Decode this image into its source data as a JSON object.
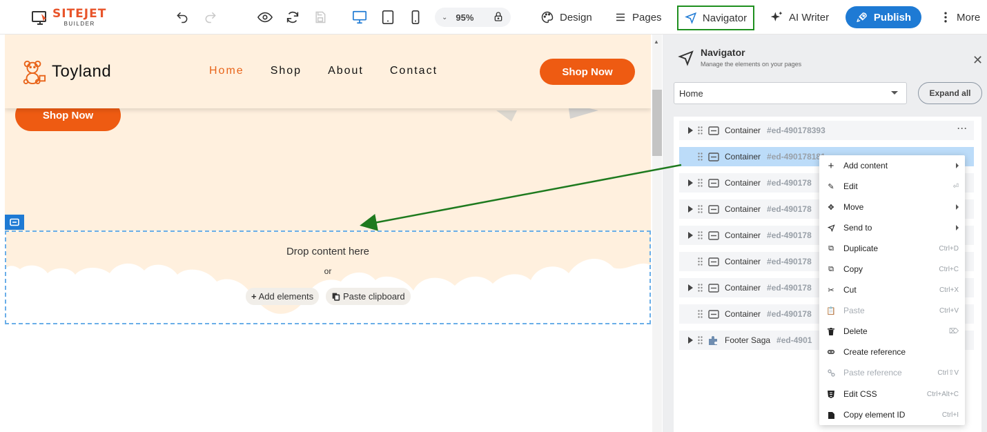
{
  "toolbar": {
    "logo_main": "SITEJET",
    "logo_sub": "BUILDER",
    "zoom": "95%",
    "design_label": "Design",
    "pages_label": "Pages",
    "navigator_label": "Navigator",
    "ai_writer_label": "AI Writer",
    "publish_label": "Publish",
    "more_label": "More"
  },
  "site": {
    "brand": "Toyland",
    "menu": [
      "Home",
      "Shop",
      "About",
      "Contact"
    ],
    "header_cta": "Shop Now",
    "hero_cta": "Shop Now",
    "drop_text": "Drop content here",
    "or_text": "or",
    "add_elements": "Add elements",
    "paste_clipboard": "Paste clipboard"
  },
  "navigator": {
    "title": "Navigator",
    "subtitle": "Manage the elements on your pages",
    "page_select": "Home",
    "expand_all": "Expand all",
    "rows": [
      {
        "type": "Container",
        "id": "#ed-490178393",
        "expandable": true,
        "selected": false
      },
      {
        "type": "Container",
        "id": "#ed-490178181",
        "expandable": false,
        "selected": true
      },
      {
        "type": "Container",
        "id": "#ed-490178",
        "expandable": true,
        "selected": false
      },
      {
        "type": "Container",
        "id": "#ed-490178",
        "expandable": true,
        "selected": false
      },
      {
        "type": "Container",
        "id": "#ed-490178",
        "expandable": true,
        "selected": false
      },
      {
        "type": "Container",
        "id": "#ed-490178",
        "expandable": false,
        "selected": false
      },
      {
        "type": "Container",
        "id": "#ed-490178",
        "expandable": true,
        "selected": false
      },
      {
        "type": "Container",
        "id": "#ed-490178",
        "expandable": false,
        "selected": false
      },
      {
        "type": "Footer Saga",
        "id": "#ed-4901",
        "expandable": true,
        "selected": false
      }
    ]
  },
  "context_menu": {
    "items": [
      {
        "label": "Add content",
        "shortcut": "",
        "submenu": true,
        "disabled": false,
        "icon": "plus-icon"
      },
      {
        "label": "Edit",
        "shortcut": "⏎",
        "submenu": false,
        "disabled": false,
        "icon": "pencil-icon"
      },
      {
        "label": "Move",
        "shortcut": "",
        "submenu": true,
        "disabled": false,
        "icon": "move-icon"
      },
      {
        "label": "Send to",
        "shortcut": "",
        "submenu": true,
        "disabled": false,
        "icon": "send-icon"
      },
      {
        "label": "Duplicate",
        "shortcut": "Ctrl+D",
        "submenu": false,
        "disabled": false,
        "icon": "duplicate-icon"
      },
      {
        "label": "Copy",
        "shortcut": "Ctrl+C",
        "submenu": false,
        "disabled": false,
        "icon": "copy-icon"
      },
      {
        "label": "Cut",
        "shortcut": "Ctrl+X",
        "submenu": false,
        "disabled": false,
        "icon": "scissors-icon"
      },
      {
        "label": "Paste",
        "shortcut": "Ctrl+V",
        "submenu": false,
        "disabled": true,
        "icon": "paste-icon"
      },
      {
        "label": "Delete",
        "shortcut": "⌦",
        "submenu": false,
        "disabled": false,
        "icon": "trash-icon"
      },
      {
        "label": "Create reference",
        "shortcut": "",
        "submenu": false,
        "disabled": false,
        "icon": "link-icon"
      },
      {
        "label": "Paste reference",
        "shortcut": "Ctrl⇧V",
        "submenu": false,
        "disabled": true,
        "icon": "link-paste-icon"
      },
      {
        "label": "Edit CSS",
        "shortcut": "Ctrl+Alt+C",
        "submenu": false,
        "disabled": false,
        "icon": "css-icon"
      },
      {
        "label": "Copy element ID",
        "shortcut": "Ctrl+I",
        "submenu": false,
        "disabled": false,
        "icon": "id-icon"
      }
    ]
  },
  "colors": {
    "accent": "#1e7ad4",
    "brand_orange": "#ee5b12",
    "hero_bg": "#fff0de",
    "highlight_green": "#1e8f1e"
  }
}
